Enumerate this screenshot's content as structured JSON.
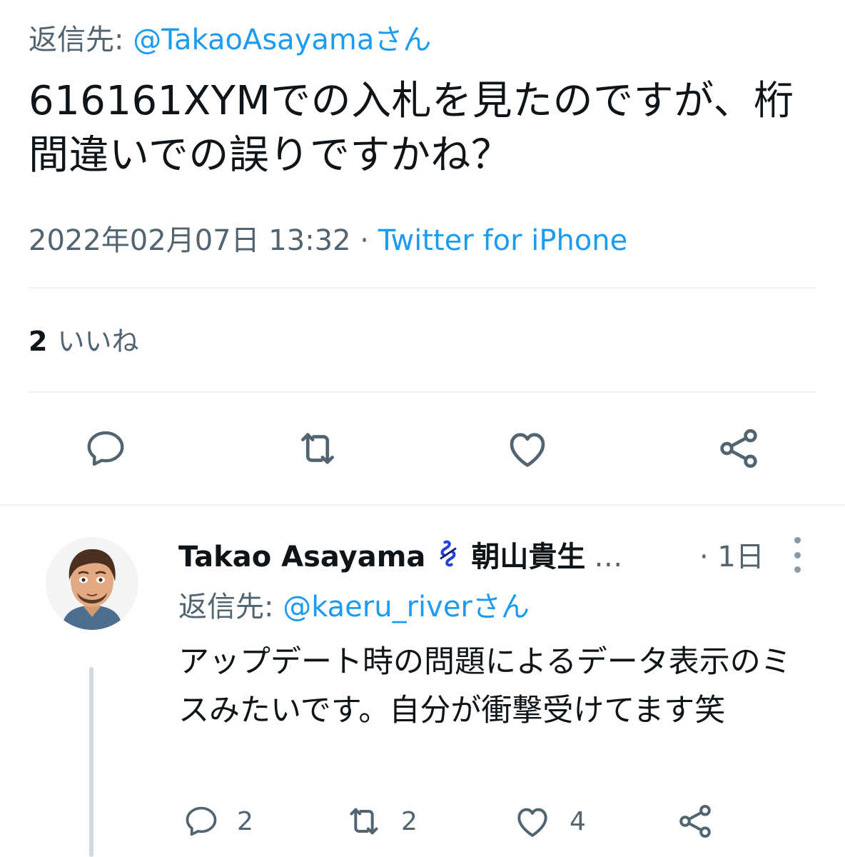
{
  "main_tweet": {
    "reply_prefix": "返信先: ",
    "reply_mention": "@TakaoAsayamaさん",
    "text": "616161XYMでの入札を見たのですが、桁間違いでの誤りですかね？",
    "timestamp": "2022年02月07日 13:32 · ",
    "source": "Twitter for iPhone",
    "likes_count": "2",
    "likes_label": "いいね",
    "actions": [
      "reply-icon",
      "retweet-icon",
      "like-icon",
      "share-icon"
    ]
  },
  "reply_tweet": {
    "author_name": "Takao Asayama",
    "author_jp_name": "朝山貴生",
    "ellipsis": "…",
    "time": "· 1日",
    "reply_prefix": "返信先: ",
    "reply_mention": "@kaeru_riverさん",
    "text": "アップデート時の問題によるデータ表示のミスみたいです。自分が衝撃受けてます笑",
    "reply_count": "2",
    "retweet_count": "2",
    "like_count": "4"
  },
  "colors": {
    "accent": "#1d9bf0",
    "secondary_text": "#536471",
    "primary_text": "#0f1419",
    "divider": "#eff3f4",
    "thread_line": "#cfd9de"
  }
}
